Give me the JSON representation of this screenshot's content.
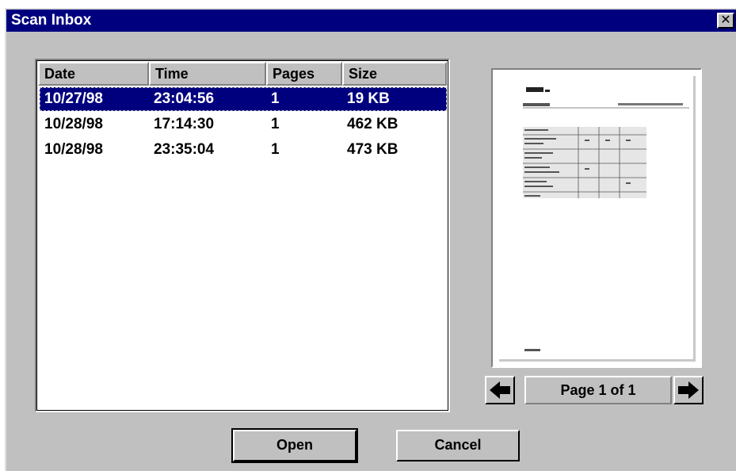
{
  "window": {
    "title": "Scan Inbox",
    "close_glyph": "✕"
  },
  "columns": [
    "Date",
    "Time",
    "Pages",
    "Size"
  ],
  "rows": [
    {
      "date": "10/27/98",
      "time": "23:04:56",
      "pages": "1",
      "size": "19 KB",
      "selected": true
    },
    {
      "date": "10/28/98",
      "time": "17:14:30",
      "pages": "1",
      "size": "462 KB",
      "selected": false
    },
    {
      "date": "10/28/98",
      "time": "23:35:04",
      "pages": "1",
      "size": "473 KB",
      "selected": false
    }
  ],
  "preview": {
    "page_label": "Page 1 of 1",
    "prev_icon": "arrow-left",
    "next_icon": "arrow-right"
  },
  "buttons": {
    "open": "Open",
    "cancel": "Cancel"
  },
  "colors": {
    "titlebar": "#00007f",
    "face": "#c0c0c0",
    "selection": "#00007f"
  }
}
